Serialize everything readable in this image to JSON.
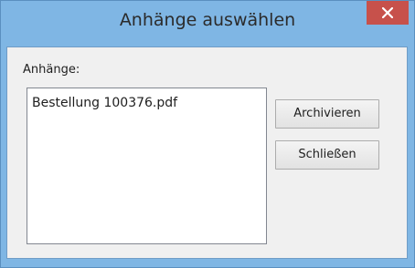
{
  "window": {
    "title": "Anhänge auswählen",
    "close_icon": "close-icon"
  },
  "attachments": {
    "label": "Anhänge:",
    "items": [
      "Bestellung 100376.pdf"
    ]
  },
  "buttons": {
    "archive_label": "Archivieren",
    "close_label": "Schließen"
  },
  "colors": {
    "titlebar": "#7fb6e4",
    "close_button": "#c7514b"
  }
}
